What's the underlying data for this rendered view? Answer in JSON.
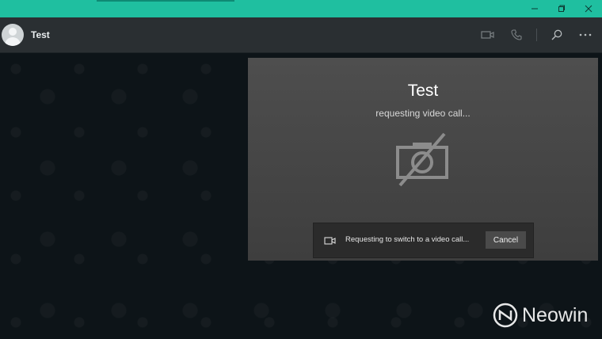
{
  "header": {
    "contact_name": "Test"
  },
  "call": {
    "title": "Test",
    "status": "requesting video call...",
    "notification_text": "Requesting to switch to a video call...",
    "cancel_label": "Cancel"
  },
  "watermark": {
    "brand": "Neowin"
  },
  "icons": {
    "header": [
      "video-call-icon",
      "voice-call-icon",
      "search-icon",
      "more-options-icon"
    ],
    "window": [
      "minimize-icon",
      "restore-icon",
      "close-icon"
    ],
    "call_panel": [
      "camera-off-icon"
    ],
    "notification": [
      "video-camera-icon"
    ]
  },
  "colors": {
    "titlebar": "#1fbfa0",
    "header": "#2a2f32",
    "chat_background": "#0d1418",
    "call_panel": "#4a4a4a"
  }
}
